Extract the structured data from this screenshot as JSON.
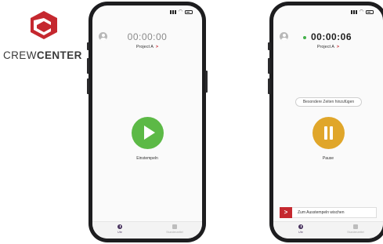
{
  "logo": {
    "crew": "CREW",
    "center": "CENTER",
    "brand_color": "#c5282f"
  },
  "phones": [
    {
      "timer": "00:00:00",
      "project": "Project A",
      "project_chevron": ">",
      "action_caption": "Einstempeln",
      "action_color": "#5cb946",
      "tabs": [
        {
          "label": "Uhr"
        },
        {
          "label": "Stundenzettel"
        }
      ]
    },
    {
      "timer": "00:00:06",
      "project": "Project A",
      "project_chevron": ">",
      "special_time": "Besondere Zeiten hinzufügen",
      "action_caption": "Pause",
      "action_color": "#e0a62a",
      "swipe_handle": ">",
      "swipe_label": "Zum Ausstempeln wischen",
      "tabs": [
        {
          "label": "Uhr"
        },
        {
          "label": "Stundenzettel"
        }
      ]
    }
  ]
}
